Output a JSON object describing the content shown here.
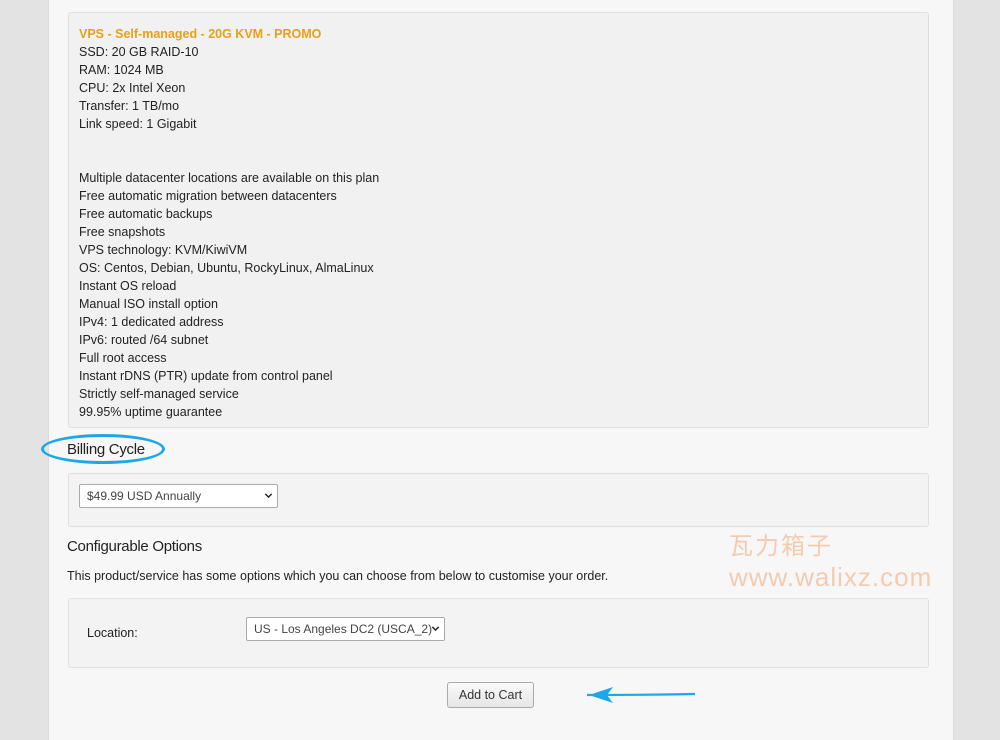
{
  "product": {
    "title": "VPS - Self-managed - 20G KVM - PROMO",
    "specs": [
      "SSD: 20 GB RAID-10",
      "RAM: 1024 MB",
      "CPU: 2x Intel Xeon",
      "Transfer: 1 TB/mo",
      "Link speed: 1 Gigabit"
    ],
    "features": [
      "Multiple datacenter locations are available on this plan",
      "Free automatic migration between datacenters",
      "Free automatic backups",
      "Free snapshots",
      "VPS technology: KVM/KiwiVM",
      "OS: Centos, Debian, Ubuntu, RockyLinux, AlmaLinux",
      "Instant OS reload",
      "Manual ISO install option",
      "IPv4: 1 dedicated address",
      "IPv6: routed /64 subnet",
      "Full root access",
      "Instant rDNS (PTR) update from control panel",
      "Strictly self-managed service",
      "99.95% uptime guarantee"
    ]
  },
  "billing": {
    "heading": "Billing Cycle",
    "selected": "$49.99 USD Annually"
  },
  "config": {
    "heading": "Configurable Options",
    "description": "This product/service has some options which you can choose from below to customise your order.",
    "location_label": "Location:",
    "location_selected": "US - Los Angeles DC2 (USCA_2)"
  },
  "actions": {
    "add_to_cart": "Add to Cart"
  },
  "watermark": {
    "line1": "瓦力箱子",
    "line2": "www.walixz.com"
  },
  "colors": {
    "title_orange": "#e8a01b",
    "annotation_blue": "#1ea6ea"
  },
  "icons": {
    "select_chevron": "chevron-down-icon",
    "annotation_arrow": "arrow-left-icon"
  }
}
